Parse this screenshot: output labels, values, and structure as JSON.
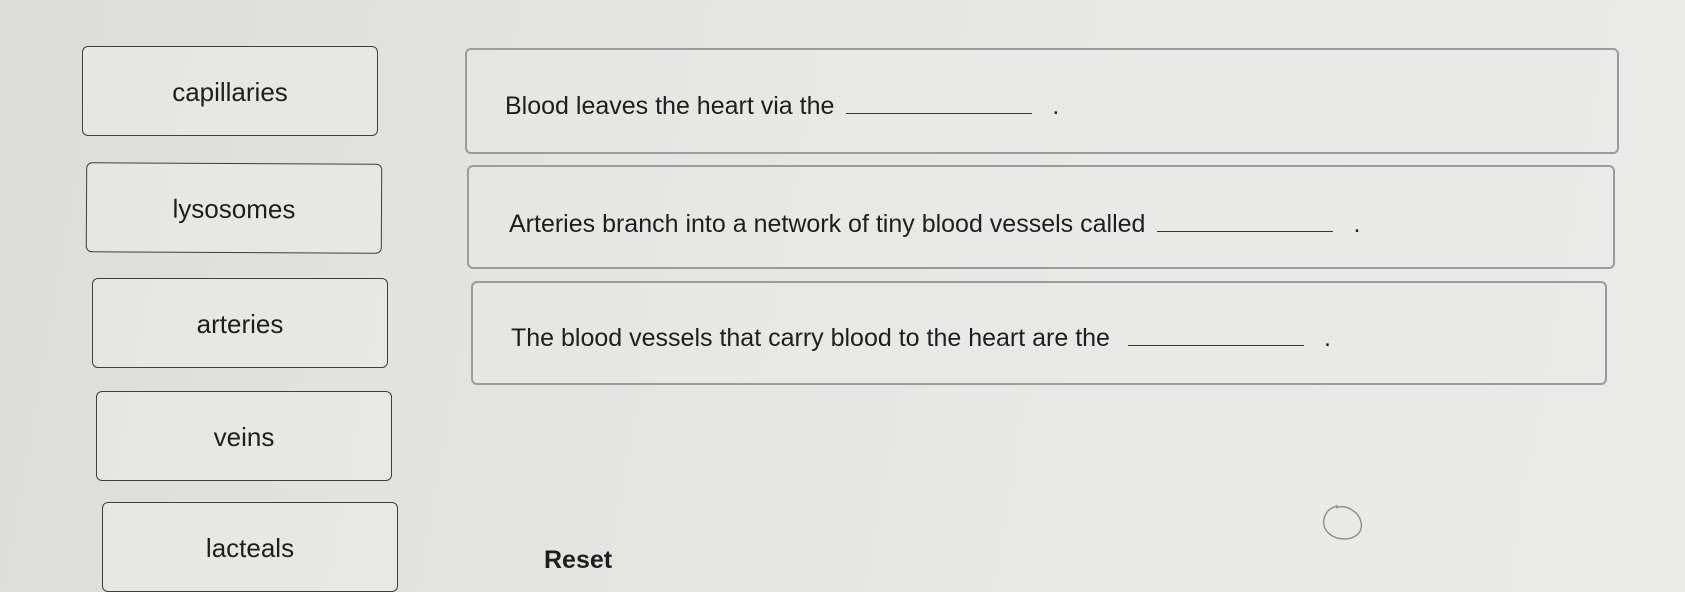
{
  "answer_options": [
    {
      "label": "capillaries"
    },
    {
      "label": "lysosomes"
    },
    {
      "label": "arteries"
    },
    {
      "label": "veins"
    },
    {
      "label": "lacteals"
    }
  ],
  "questions": [
    {
      "text": "Blood leaves the heart via the",
      "end": "."
    },
    {
      "text": "Arteries branch into a network of tiny blood vessels called",
      "end": "."
    },
    {
      "text": "The blood vessels that carry blood to the heart are the",
      "end": "."
    }
  ],
  "reset_label": "Reset"
}
